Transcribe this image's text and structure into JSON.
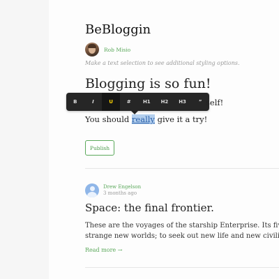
{
  "app": {
    "title": "BeBloggin"
  },
  "author": {
    "name": "Rob Misio"
  },
  "editor": {
    "hint": "Make a text selection to see additional styling options.",
    "title": "Blogging is so fun!",
    "line1_tail": "self!",
    "line2_before": "You should ",
    "line2_selected": "really",
    "line2_after": " give it a try!",
    "publish_label": "Publish"
  },
  "toolbar": {
    "items": [
      {
        "label": "B",
        "name": "bold-button",
        "active": false
      },
      {
        "label": "I",
        "name": "italic-button",
        "active": false
      },
      {
        "label": "U",
        "name": "underline-button",
        "active": true
      },
      {
        "label": "#",
        "name": "link-button",
        "active": false
      },
      {
        "label": "H1",
        "name": "h1-button",
        "active": false
      },
      {
        "label": "H2",
        "name": "h2-button",
        "active": false
      },
      {
        "label": "H3",
        "name": "h3-button",
        "active": false
      },
      {
        "label": "”",
        "name": "quote-button",
        "active": false
      }
    ]
  },
  "posts": [
    {
      "author": "Drew Engelson",
      "time": "3 months ago",
      "title": "Space: the final frontier.",
      "excerpt_lines": [
        "These are the voyages of the starship Enterprise. Its five-year mission: to explore",
        "strange new worlds; to seek out new life and new civilizations"
      ],
      "read_more": "Read more →"
    }
  ],
  "colors": {
    "accent_green": "#5aa85a",
    "selection": "#b3cfee",
    "toolbar_bg": "#262626",
    "active_tool": "#ffd400"
  }
}
